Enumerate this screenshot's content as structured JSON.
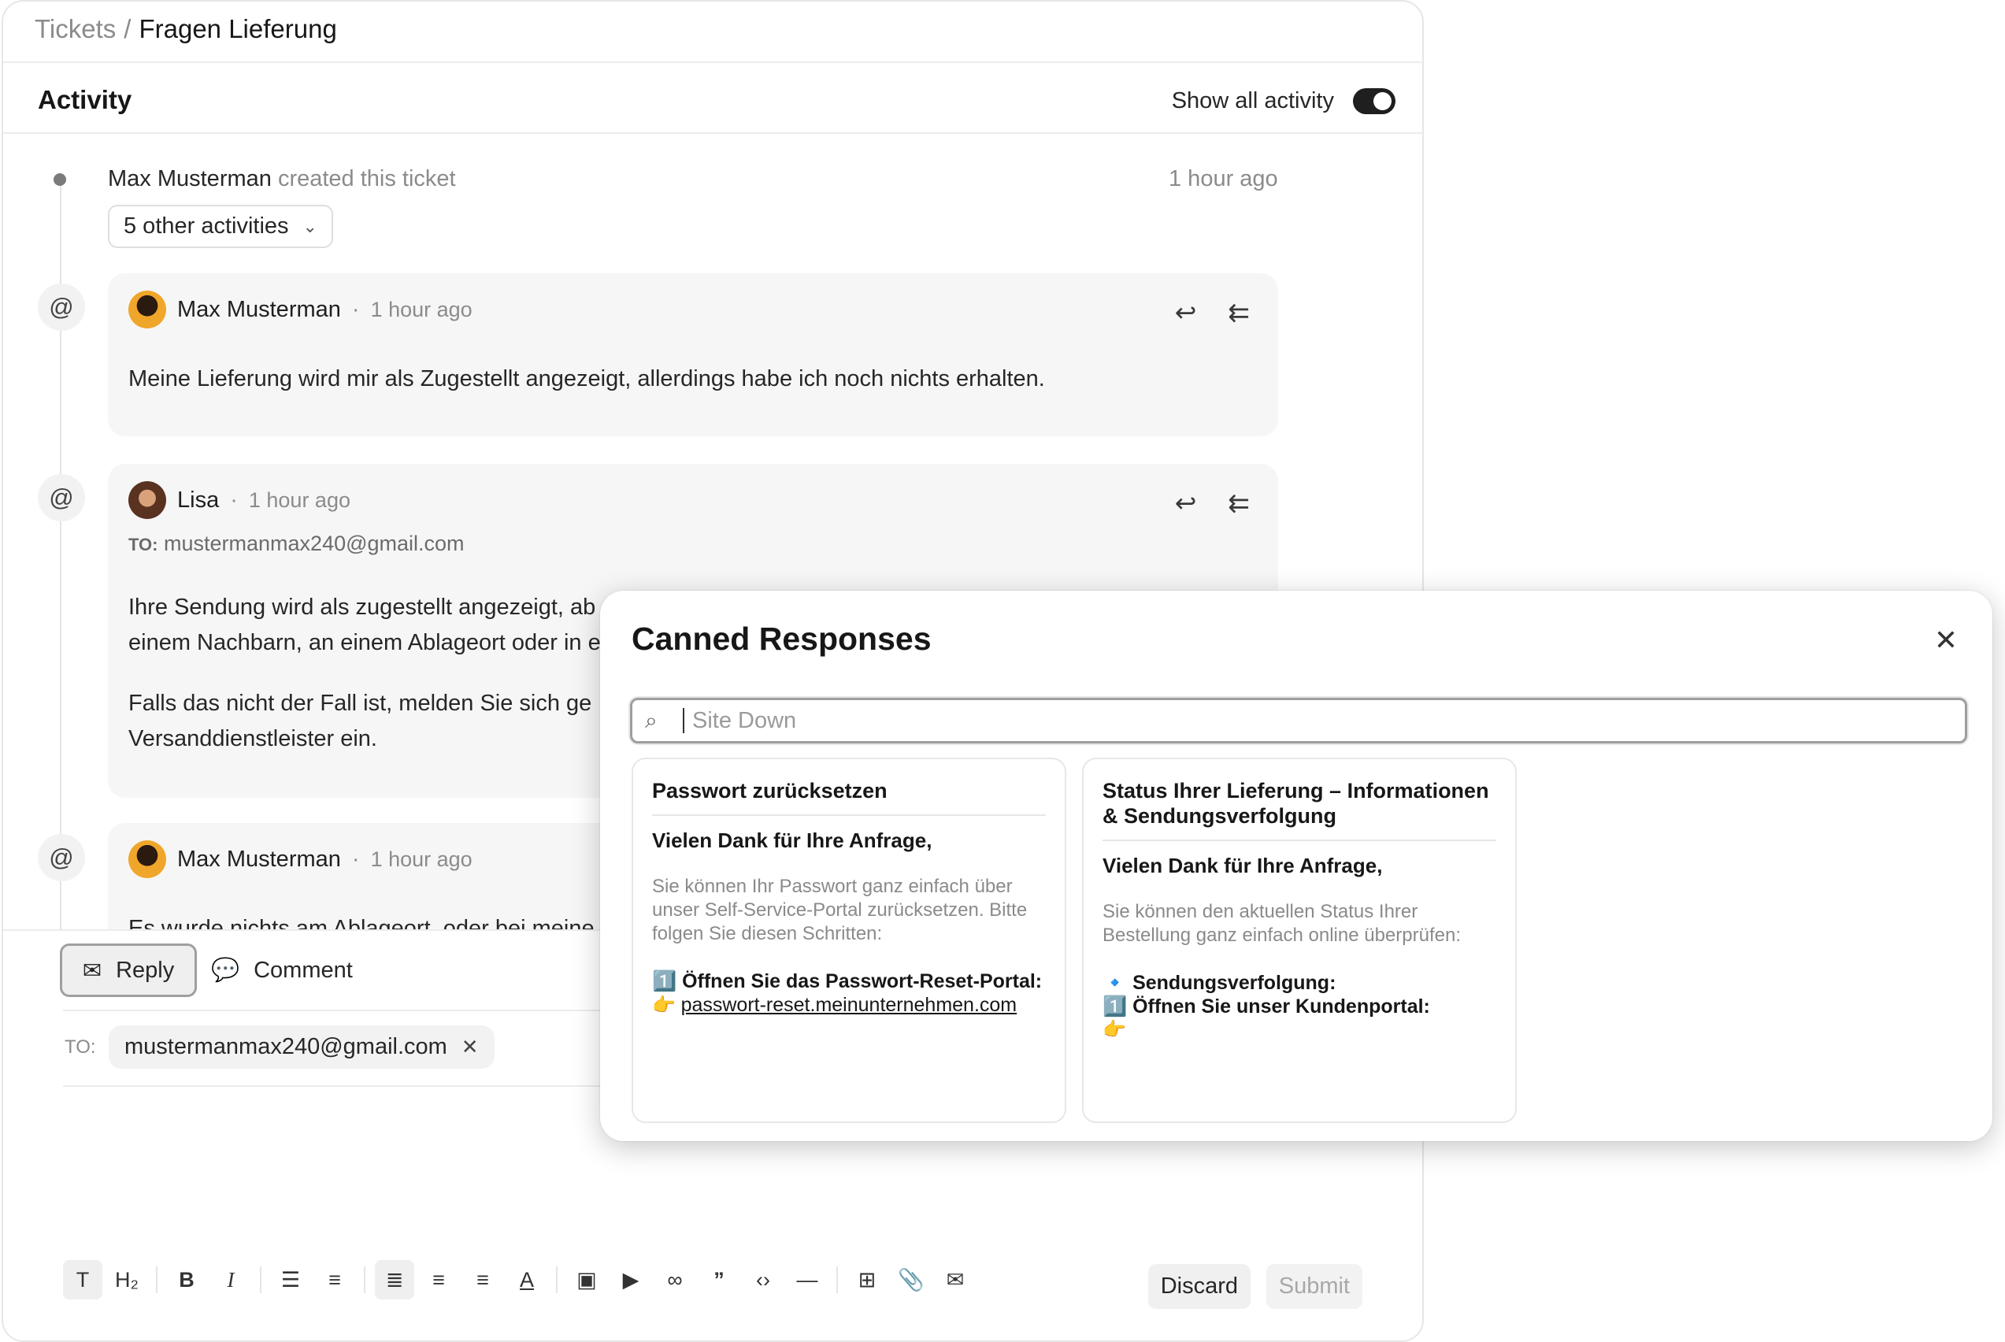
{
  "breadcrumb": {
    "root": "Tickets",
    "separator": "/",
    "current": "Fragen Lieferung"
  },
  "activity": {
    "title": "Activity",
    "show_all_label": "Show all activity",
    "show_all_on": true
  },
  "created": {
    "name": "Max Musterman",
    "text": "created this ticket",
    "time": "1 hour ago",
    "other_activities": "5 other activities"
  },
  "messages": [
    {
      "name": "Max Musterman",
      "time": "1 hour ago",
      "body": "Meine Lieferung wird mir als Zugestellt angezeigt, allerdings habe ich noch nichts erhalten."
    },
    {
      "name": "Lisa",
      "time": "1 hour ago",
      "to_label": "TO:",
      "to": "mustermanmax240@gmail.com",
      "body_1": "Ihre Sendung wird als zugestellt angezeigt, ab",
      "body_2": "einem Nachbarn, an einem Ablageort oder in e",
      "body_3": "Falls das nicht der Fall ist, melden Sie sich ge",
      "body_4": "Versanddienstleister ein."
    },
    {
      "name": "Max Musterman",
      "time": "1 hour ago",
      "body": "Es wurde nichts am Ablageort, oder bei meine"
    }
  ],
  "composer": {
    "reply_label": "Reply",
    "comment_label": "Comment",
    "to_label": "TO:",
    "to_chip": "mustermanmax240@gmail.com",
    "discard_label": "Discard",
    "submit_label": "Submit"
  },
  "canned": {
    "title": "Canned Responses",
    "search_placeholder": "Site Down",
    "cards": [
      {
        "title": "Passwort zurücksetzen",
        "greeting": "Vielen Dank für Ihre Anfrage,",
        "text": "Sie können Ihr Passwort ganz einfach über unser Self-Service-Portal zurücksetzen. Bitte folgen Sie diesen Schritten:",
        "step": "1️⃣ Öffnen Sie das Passwort-Reset-Portal:",
        "link_prefix": "👉 ",
        "link": "passwort-reset.meinunternehmen.com"
      },
      {
        "title": "Status Ihrer Lieferung – Informationen & Sendungsverfolgung",
        "greeting": "Vielen Dank für Ihre Anfrage,",
        "text": "Sie können den aktuellen Status Ihrer Bestellung ganz einfach online überprüfen:",
        "step_1": "🔹 Sendungsverfolgung:",
        "step_2": "1️⃣ Öffnen Sie unser Kundenportal:",
        "link_prefix": "👉"
      }
    ]
  }
}
